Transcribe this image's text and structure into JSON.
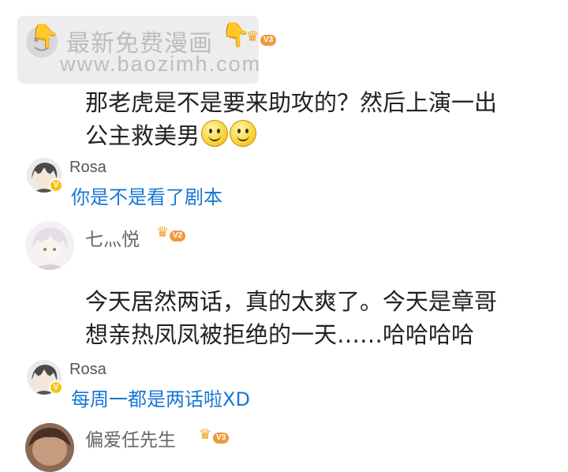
{
  "watermark": {
    "line1": "最新免费漫画",
    "line2": "www.baozimh.com"
  },
  "comments": [
    {
      "level": "V3",
      "text_line1": "那老虎是不是要来助攻的？然后上演一出",
      "text_line2": "公主救美男",
      "emoji": "smiley-icon",
      "reply": {
        "username": "Rosa",
        "text": "你是不是看了剧本"
      }
    },
    {
      "username": "七灬悦",
      "level": "V2",
      "text_line1": "今天居然两话，真的太爽了。今天是章哥",
      "text_line2": "想亲热凤凤被拒绝的一天……哈哈哈哈",
      "reply": {
        "username": "Rosa",
        "text": "每周一都是两话啦XD"
      }
    },
    {
      "username": "偏爱任先生",
      "level": "V3"
    }
  ],
  "colors": {
    "reply_text": "#1777d6",
    "badge": "#ee9a3f",
    "crown": "#f3a21d"
  }
}
